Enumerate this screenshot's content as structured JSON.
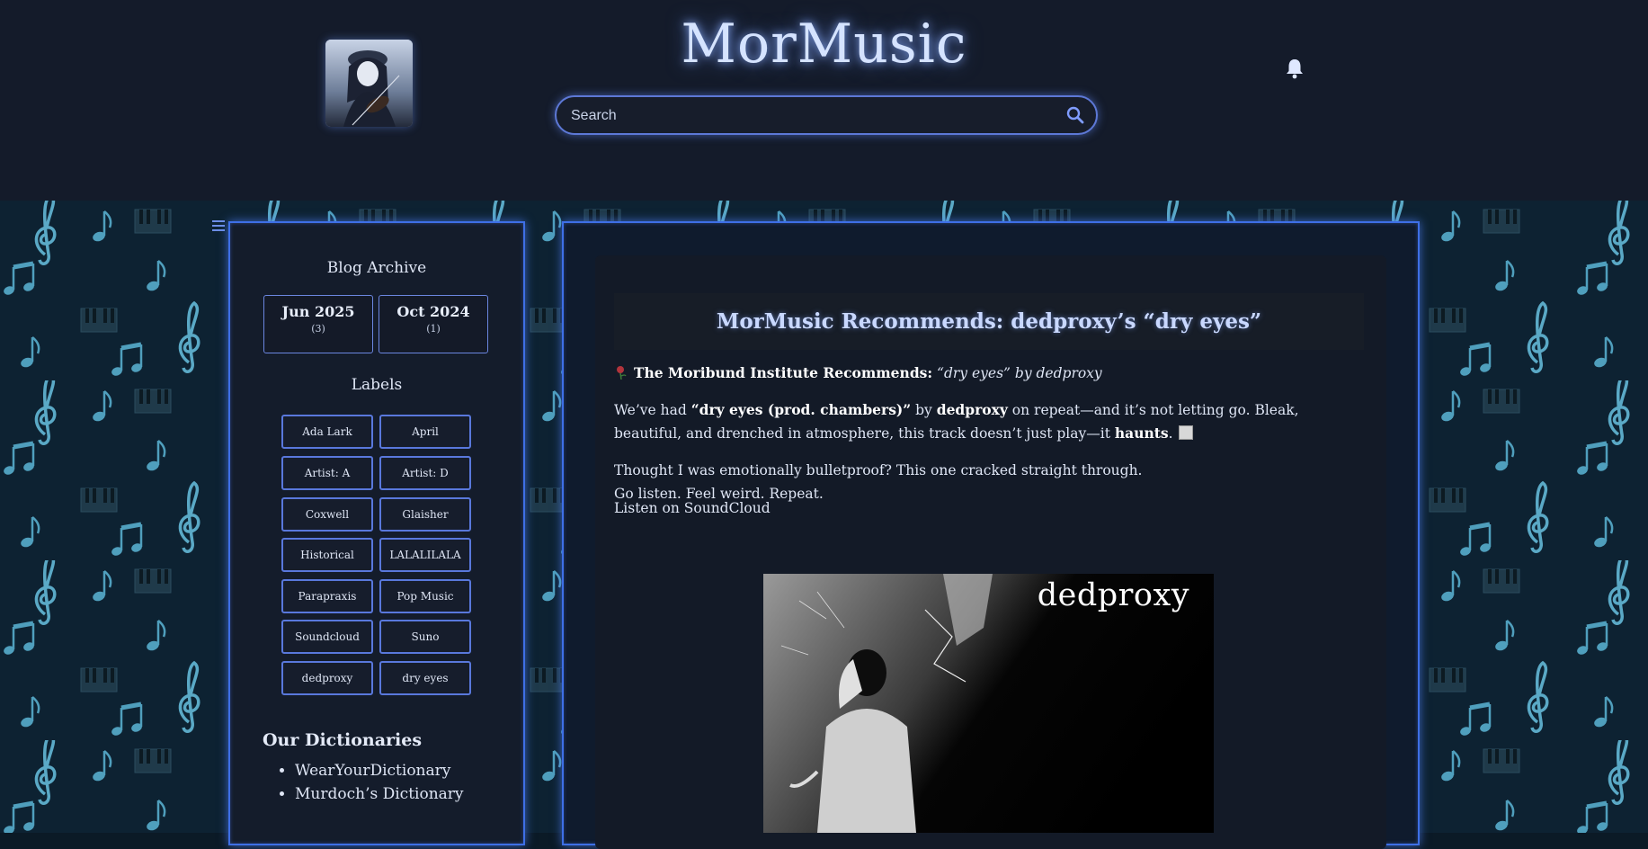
{
  "header": {
    "site_title": "MorMusic",
    "search_placeholder": "Search",
    "avatar_icon": "violinist-avatar-icon",
    "notification_icon": "bell-icon",
    "search_icon": "magnifier-icon"
  },
  "sidebar": {
    "archive_title": "Blog Archive",
    "archive": [
      {
        "month": "Jun 2025",
        "count": "(3)"
      },
      {
        "month": "Oct 2024",
        "count": "(1)"
      }
    ],
    "labels_title": "Labels",
    "labels": [
      "Ada Lark",
      "April",
      "Artist: A",
      "Artist: D",
      "Coxwell",
      "Glaisher",
      "Historical",
      "LALALILALA",
      "Parapraxis",
      "Pop Music",
      "Soundcloud",
      "Suno",
      "dedproxy",
      "dry eyes"
    ],
    "dictionaries_title": "Our Dictionaries",
    "dictionaries": [
      "WearYourDictionary",
      "Murdoch’s Dictionary"
    ]
  },
  "post": {
    "title": "MorMusic Recommends: dedproxy’s “dry eyes”",
    "intro_bold": "The Moribund Institute Recommends:",
    "intro_italic": "“dry eyes” by dedproxy",
    "p1_a": "We’ve had ",
    "p1_b": "“dry eyes (prod. chambers)”",
    "p1_c": " by ",
    "p1_d": "dedproxy",
    "p1_e": " on repeat—and it’s not letting go. Bleak, beautiful, and drenched in atmosphere, this track doesn’t just play—it ",
    "p1_f": "haunts",
    "p1_g": ".",
    "p2_line1": "Thought I was emotionally bulletproof? This one cracked straight through.",
    "p2_line2": "Go listen. Feel weird. Repeat.",
    "listen_link": "Listen on SoundCloud",
    "cover_artist": "dedproxy"
  },
  "colors": {
    "accent": "#3e6fe6",
    "header_bg": "#141b2a",
    "title_glow": "#d5e3ff",
    "pattern_note": "#5aa9c6"
  }
}
